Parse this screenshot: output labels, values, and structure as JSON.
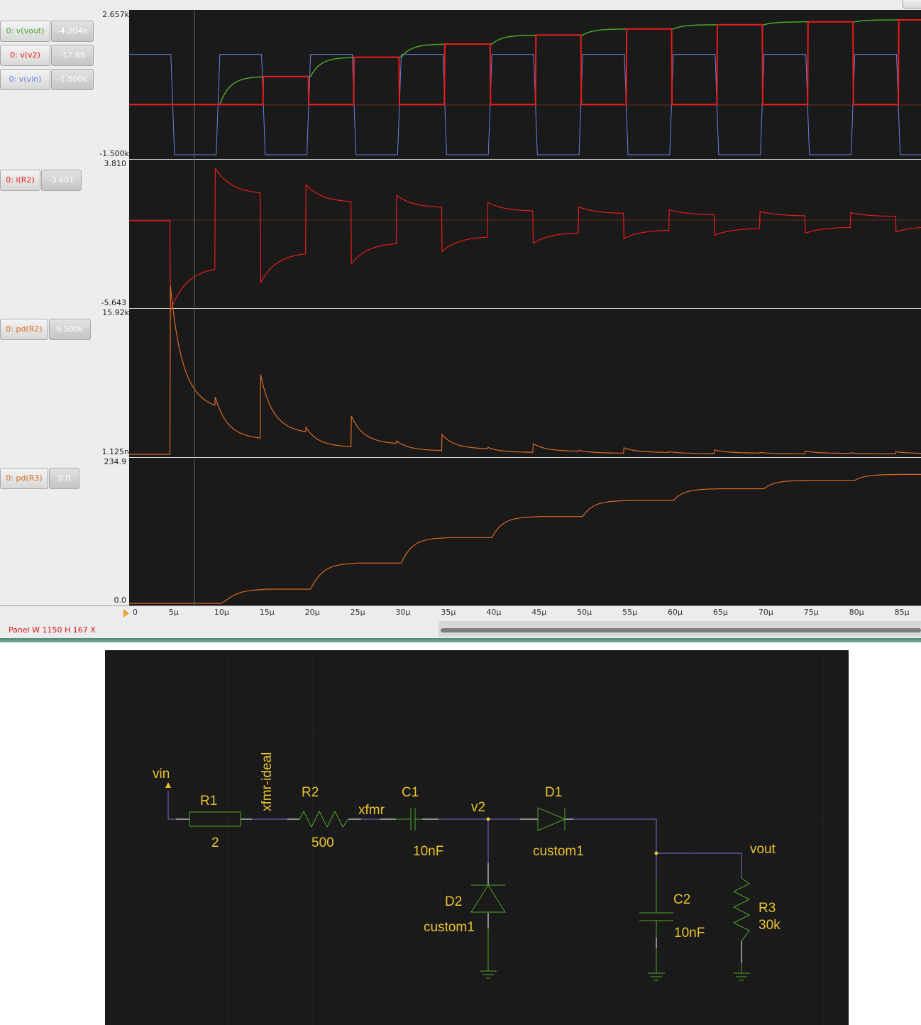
{
  "colors": {
    "plot_bg": "#1a1a1a",
    "vout": "#4ea52a",
    "v2": "#e81c1c",
    "vin": "#6b7fe0",
    "power": "#dc6a22",
    "schematic_wire": "#6f74d6",
    "schematic_part": "#52a52b",
    "schematic_text": "#e9c431"
  },
  "panels": [
    {
      "id": "voltages",
      "ymax_label": "2.657k",
      "ymin_label": "-1.500k",
      "traces": [
        {
          "name": "0: v(vout)",
          "value": "-4.204n",
          "color": "#4ea52a"
        },
        {
          "name": "0: v(v2)",
          "value": "-17.69",
          "color": "#e81c1c"
        },
        {
          "name": "0: v(vin)",
          "value": "-1.500k",
          "color": "#6b7fe0"
        }
      ]
    },
    {
      "id": "current",
      "ymax_label": "3.810",
      "ymin_label": "-5.643",
      "traces": [
        {
          "name": "0: i(R2)",
          "value": "-3.601",
          "color": "#e81c1c"
        }
      ]
    },
    {
      "id": "power-r2",
      "ymax_label": "15.92k",
      "ymin_label": "1.125n",
      "traces": [
        {
          "name": "0: pd(R2)",
          "value": "6.500k",
          "color": "#dc6a22"
        }
      ]
    },
    {
      "id": "power-r3",
      "ymax_label": "234.9",
      "ymin_label": "0.0",
      "traces": [
        {
          "name": "0: pd(R3)",
          "value": "0.0",
          "color": "#dc6a22"
        }
      ]
    }
  ],
  "time_axis": {
    "ticks": [
      "0",
      "5µ",
      "10µ",
      "15µ",
      "20µ",
      "25µ",
      "30µ",
      "35µ",
      "40µ",
      "45µ",
      "50µ",
      "55µ",
      "60µ",
      "65µ",
      "70µ",
      "75µ",
      "80µ",
      "85µ"
    ],
    "range_us": [
      0,
      87.3
    ],
    "cursor_us": 7.2
  },
  "status_text": "Panel W 1150 H 167 X",
  "schematic": {
    "labels": {
      "vin": "vin",
      "xfmr_ideal": "xfmr-ideal",
      "xfmr": "xfmr",
      "v2": "v2",
      "vout": "vout"
    },
    "components": {
      "R1": {
        "ref": "R1",
        "value": "2"
      },
      "R2": {
        "ref": "R2",
        "value": "500"
      },
      "C1": {
        "ref": "C1",
        "value": "10nF"
      },
      "D1": {
        "ref": "D1",
        "value": "custom1"
      },
      "D2": {
        "ref": "D2",
        "value": "custom1"
      },
      "C2": {
        "ref": "C2",
        "value": "10nF"
      },
      "R3": {
        "ref": "R3",
        "value": "30k"
      }
    }
  }
}
